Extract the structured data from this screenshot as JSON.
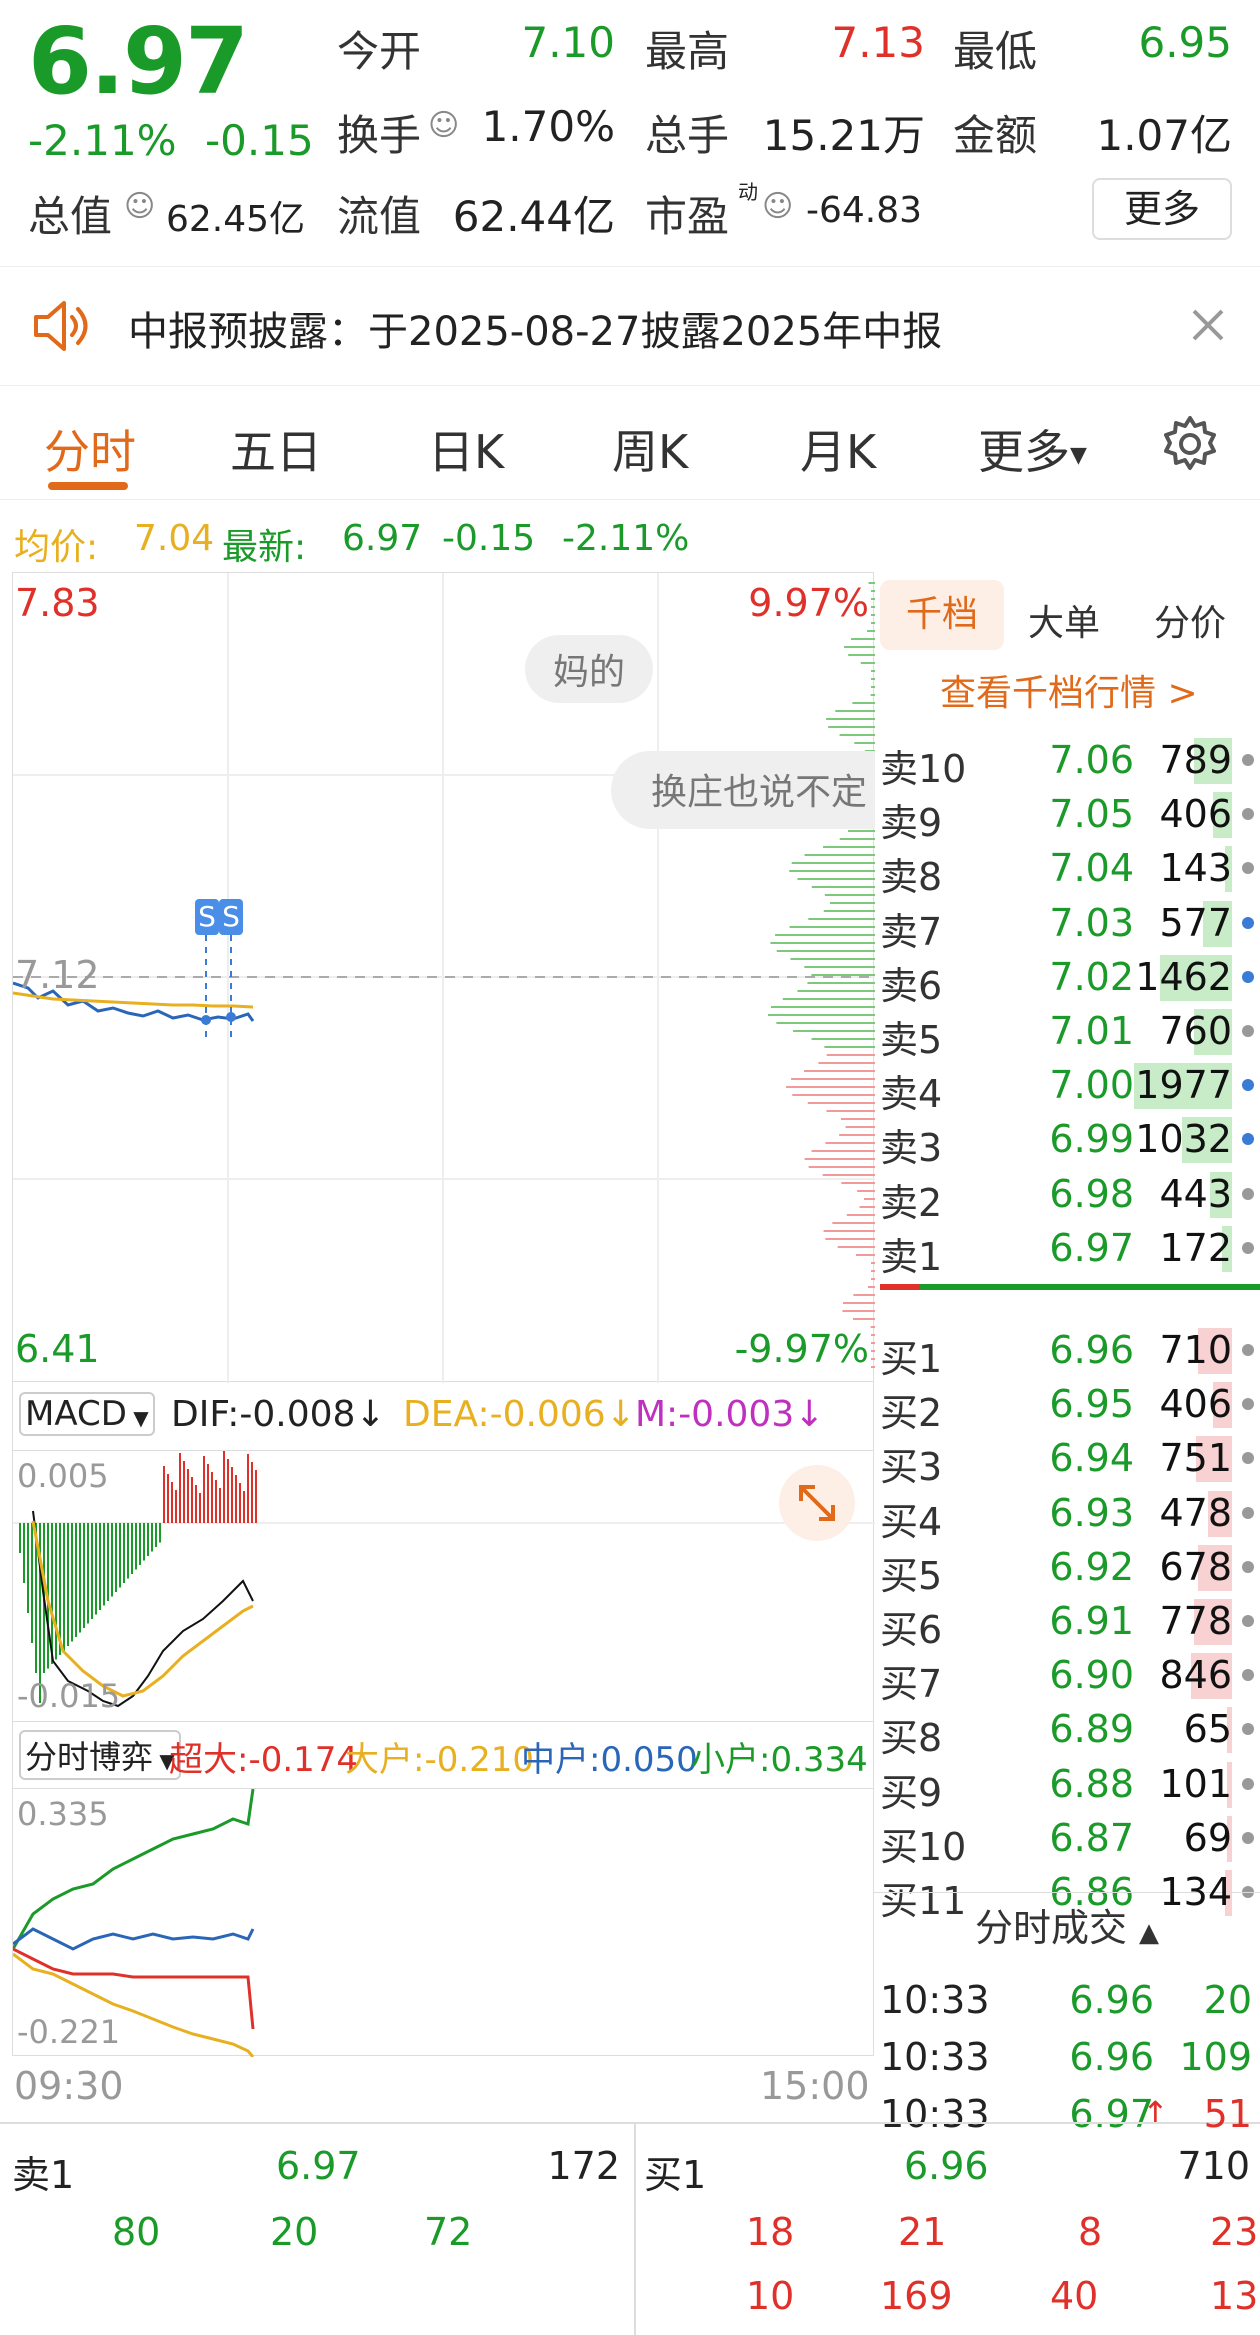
{
  "quote": {
    "price": "6.97",
    "change_pct": "-2.11%",
    "change": "-0.15",
    "items": [
      {
        "label": "今开",
        "value": "7.10",
        "color": "#1a9a28"
      },
      {
        "label": "最高",
        "value": "7.13",
        "color": "#e0302a"
      },
      {
        "label": "最低",
        "value": "6.95",
        "color": "#1a9a28"
      },
      {
        "label": "换手",
        "value": "1.70%",
        "color": "#222"
      },
      {
        "label": "总手",
        "value": "15.21万",
        "color": "#222"
      },
      {
        "label": "金额",
        "value": "1.07亿",
        "color": "#222"
      },
      {
        "label": "总值",
        "value": "62.45亿",
        "color": "#222"
      },
      {
        "label": "流值",
        "value": "62.44亿",
        "color": "#222"
      },
      {
        "label": "市盈",
        "value": "-64.83",
        "color": "#222"
      }
    ],
    "pe_sup": "动",
    "more_label": "更多"
  },
  "notice": {
    "text": "中报预披露：于2025-08-27披露2025年中报"
  },
  "tabs": [
    "分时",
    "五日",
    "日K",
    "周K",
    "月K",
    "更多"
  ],
  "summary": {
    "avg_label": "均价:",
    "avg": "7.04",
    "last_label": "最新:",
    "last": "6.97",
    "change": "-0.15",
    "pct": "-2.11%"
  },
  "chart": {
    "y_top": "7.83",
    "y_bottom": "6.41",
    "pct_top": "9.97%",
    "pct_bottom": "-9.97%",
    "ref": "7.12",
    "bubble1": "妈的",
    "bubble2": "换庄也说不定",
    "marker": "S",
    "macd_label": "MACD",
    "dif": "DIF:-0.008↓",
    "dea": "DEA:-0.006↓",
    "m": "M:-0.003↓",
    "macd_top": "0.005",
    "macd_bottom": "-0.015",
    "flow_label": "分时博弈",
    "super": "超大:-0.174",
    "large": "大户:-0.210",
    "mid": "中户:0.050",
    "small": "小户:0.334",
    "flow_top": "0.335",
    "flow_bottom": "-0.221",
    "t_start": "09:30",
    "t_end": "15:00"
  },
  "book": {
    "tabs": [
      "千档",
      "大单",
      "分价"
    ],
    "link": "查看千档行情 >",
    "asks": [
      {
        "n": "卖10",
        "p": "7.06",
        "v": "789",
        "w": 0.16,
        "dot": "#999"
      },
      {
        "n": "卖9",
        "p": "7.05",
        "v": "406",
        "w": 0.08,
        "dot": "#999"
      },
      {
        "n": "卖8",
        "p": "7.04",
        "v": "143",
        "w": 0.03,
        "dot": "#999"
      },
      {
        "n": "卖7",
        "p": "7.03",
        "v": "577",
        "w": 0.12,
        "dot": "#3a7bd5"
      },
      {
        "n": "卖6",
        "p": "7.02",
        "v": "1462",
        "w": 0.3,
        "dot": "#3a7bd5"
      },
      {
        "n": "卖5",
        "p": "7.01",
        "v": "760",
        "w": 0.16,
        "dot": "#999"
      },
      {
        "n": "卖4",
        "p": "7.00",
        "v": "1977",
        "w": 0.41,
        "dot": "#3a7bd5"
      },
      {
        "n": "卖3",
        "p": "6.99",
        "v": "1032",
        "w": 0.21,
        "dot": "#3a7bd5"
      },
      {
        "n": "卖2",
        "p": "6.98",
        "v": "443",
        "w": 0.09,
        "dot": "#999"
      },
      {
        "n": "卖1",
        "p": "6.97",
        "v": "172",
        "w": 0.04,
        "dot": "#999"
      }
    ],
    "bids": [
      {
        "n": "买1",
        "p": "6.96",
        "v": "710",
        "w": 0.14,
        "dot": "#999"
      },
      {
        "n": "买2",
        "p": "6.95",
        "v": "406",
        "w": 0.08,
        "dot": "#999"
      },
      {
        "n": "买3",
        "p": "6.94",
        "v": "751",
        "w": 0.15,
        "dot": "#999"
      },
      {
        "n": "买4",
        "p": "6.93",
        "v": "478",
        "w": 0.1,
        "dot": "#999"
      },
      {
        "n": "买5",
        "p": "6.92",
        "v": "678",
        "w": 0.14,
        "dot": "#999"
      },
      {
        "n": "买6",
        "p": "6.91",
        "v": "778",
        "w": 0.16,
        "dot": "#999"
      },
      {
        "n": "买7",
        "p": "6.90",
        "v": "846",
        "w": 0.17,
        "dot": "#999"
      },
      {
        "n": "买8",
        "p": "6.89",
        "v": "65",
        "w": 0.02,
        "dot": "#999"
      },
      {
        "n": "买9",
        "p": "6.88",
        "v": "101",
        "w": 0.02,
        "dot": "#999"
      },
      {
        "n": "买10",
        "p": "6.87",
        "v": "69",
        "w": 0.02,
        "dot": "#999"
      },
      {
        "n": "买11",
        "p": "6.86",
        "v": "134",
        "w": 0.03,
        "dot": "#999"
      }
    ],
    "trades_title": "分时成交",
    "trades": [
      {
        "t": "10:33",
        "p": "6.96",
        "v": "20",
        "arrow": "",
        "vc": "#1a9a28"
      },
      {
        "t": "10:33",
        "p": "6.96",
        "v": "109",
        "arrow": "",
        "vc": "#1a9a28"
      },
      {
        "t": "10:33",
        "p": "6.97",
        "v": "51",
        "arrow": "↑",
        "vc": "#e0302a"
      }
    ]
  },
  "bottom": {
    "sell_label": "卖1",
    "sell_price": "6.97",
    "sell_vol": "172",
    "buy_label": "买1",
    "buy_price": "6.96",
    "buy_vol": "710",
    "sell_nums": [
      "80",
      "20",
      "72"
    ],
    "buy_nums_row1": [
      "18",
      "21",
      "8",
      "23"
    ],
    "buy_nums_row2": [
      "10",
      "169",
      "40",
      "13"
    ]
  }
}
